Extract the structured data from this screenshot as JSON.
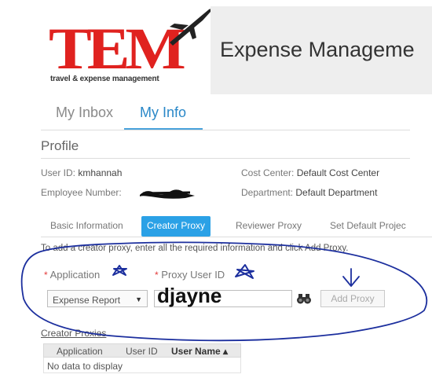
{
  "header": {
    "logo_text": "TEM",
    "logo_tagline": "travel & expense management",
    "app_title": "Expense Manageme"
  },
  "main_tabs": [
    {
      "label": "My Inbox",
      "active": false
    },
    {
      "label": "My Info",
      "active": true
    }
  ],
  "profile": {
    "heading": "Profile",
    "user_id_label": "User ID:",
    "user_id_value": "kmhannah",
    "employee_number_label": "Employee Number:",
    "cost_center_label": "Cost Center:",
    "cost_center_value": "Default Cost Center",
    "department_label": "Department:",
    "department_value": "Default Department"
  },
  "sub_tabs": [
    {
      "label": "Basic Information",
      "active": false
    },
    {
      "label": "Creator Proxy",
      "active": true
    },
    {
      "label": "Reviewer Proxy",
      "active": false
    },
    {
      "label": "Set Default Projec",
      "active": false
    }
  ],
  "creator_proxy": {
    "instruction": "To add a creator proxy, enter all the required information and click Add Proxy.",
    "required_mark": "*",
    "application_label": "Application",
    "application_selected": "Expense Report",
    "proxy_user_id_label": "Proxy User ID",
    "proxy_user_id_value": "djayne",
    "add_proxy_label": "Add Proxy"
  },
  "proxies_table": {
    "title": "Creator Proxies",
    "columns": [
      "Application",
      "User ID",
      "User Name"
    ],
    "sort_indicator": "▴",
    "empty_message": "No data to display"
  },
  "colors": {
    "brand_red": "#e0221f",
    "accent_blue": "#2ba1e6",
    "annotation_blue": "#1c2f9e"
  }
}
